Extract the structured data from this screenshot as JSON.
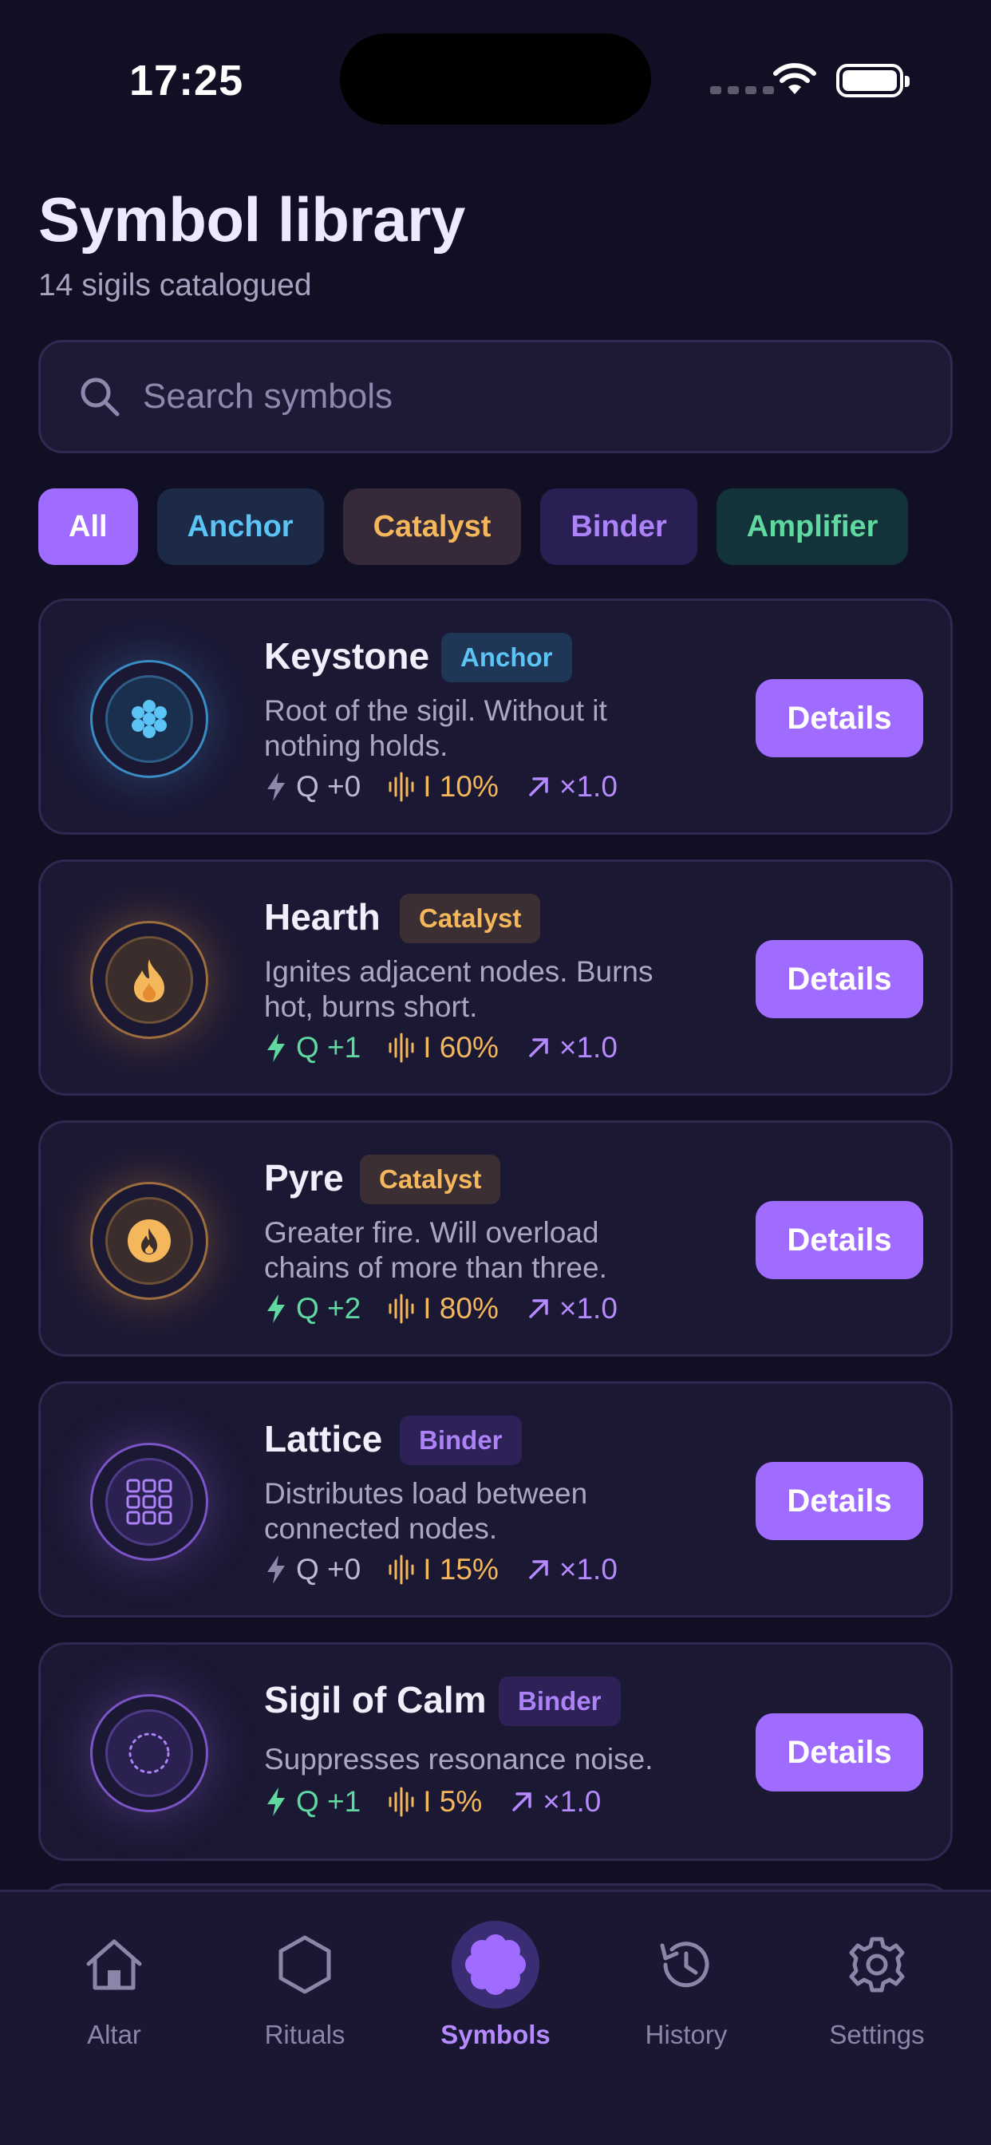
{
  "status_bar": {
    "time": "17:25"
  },
  "header": {
    "title": "Symbol library",
    "subtitle": "14 sigils catalogued"
  },
  "search": {
    "placeholder": "Search symbols",
    "value": ""
  },
  "filters": [
    {
      "label": "All",
      "selected": true
    },
    {
      "label": "Anchor",
      "selected": false
    },
    {
      "label": "Catalyst",
      "selected": false
    },
    {
      "label": "Binder",
      "selected": false
    },
    {
      "label": "Amplifier",
      "selected": false
    }
  ],
  "colors": {
    "accent": "#a06bff",
    "anchor": "#5cc4f5",
    "catalyst": "#f4b75c",
    "binder": "#ac83f7",
    "amplifier": "#5fd9a0",
    "background": "#110f24"
  },
  "symbols": [
    {
      "name": "Keystone",
      "type": "Anchor",
      "icon": "cluster-icon",
      "desc_line1": "Root of the sigil. Without it",
      "desc_line2": "nothing holds.",
      "q": "Q +0",
      "intensity": "I 10%",
      "multiplier": "×1.0",
      "button": "Details"
    },
    {
      "name": "Hearth",
      "type": "Catalyst",
      "icon": "flame-icon",
      "desc_line1": "Ignites adjacent nodes. Burns",
      "desc_line2": "hot, burns short.",
      "q": "Q +1",
      "intensity": "I 60%",
      "multiplier": "×1.0",
      "button": "Details"
    },
    {
      "name": "Pyre",
      "type": "Catalyst",
      "icon": "fire-coin-icon",
      "desc_line1": "Greater fire. Will overload",
      "desc_line2": "chains of more than three.",
      "q": "Q +2",
      "intensity": "I 80%",
      "multiplier": "×1.0",
      "button": "Details"
    },
    {
      "name": "Lattice",
      "type": "Binder",
      "icon": "grid-icon",
      "desc_line1": "Distributes load between",
      "desc_line2": "connected nodes.",
      "q": "Q +0",
      "intensity": "I 15%",
      "multiplier": "×1.0",
      "button": "Details"
    },
    {
      "name": "Sigil of Calm",
      "type": "Binder",
      "icon": "dotted-circle-icon",
      "desc_line1": "Suppresses resonance noise.",
      "desc_line2": "",
      "q": "Q +1",
      "intensity": "I 5%",
      "multiplier": "×1.0",
      "button": "Details"
    }
  ],
  "tabs": [
    {
      "label": "Altar",
      "icon": "home-icon",
      "active": false
    },
    {
      "label": "Rituals",
      "icon": "hexagon-icon",
      "active": false
    },
    {
      "label": "Symbols",
      "icon": "flower-badge-icon",
      "active": true
    },
    {
      "label": "History",
      "icon": "history-icon",
      "active": false
    },
    {
      "label": "Settings",
      "icon": "gear-icon",
      "active": false
    }
  ]
}
